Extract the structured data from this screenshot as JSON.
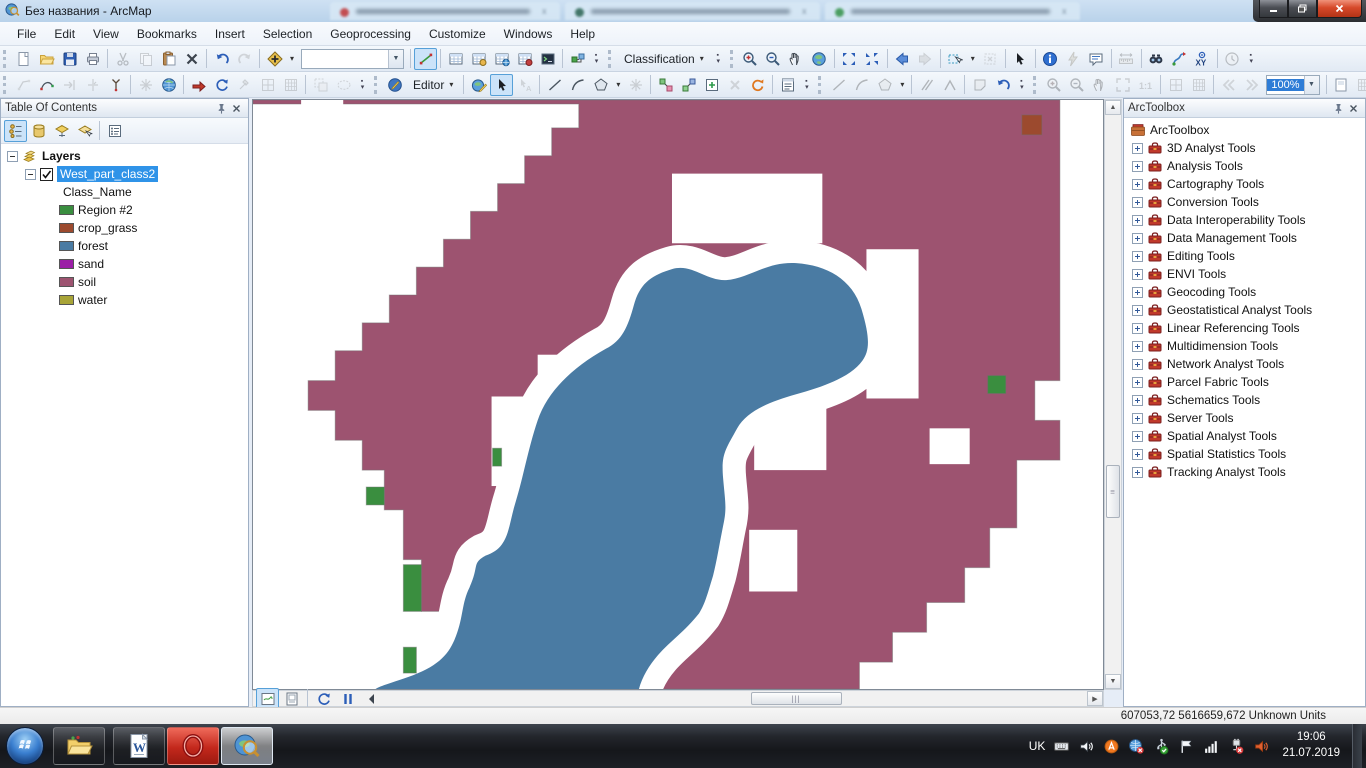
{
  "window": {
    "title": "Без названия - ArcMap",
    "controls": {
      "minimize": "minimize",
      "restore": "restore",
      "close": "close"
    }
  },
  "menubar": [
    "File",
    "Edit",
    "View",
    "Bookmarks",
    "Insert",
    "Selection",
    "Geoprocessing",
    "Customize",
    "Windows",
    "Help"
  ],
  "toolbars": {
    "row1": [
      {
        "tool": "standard",
        "items": [
          "grip",
          "icon:new-document",
          "icon:open-folder",
          "icon:save",
          "icon:print",
          "sep",
          "icon:cut:disabled",
          "icon:copy:disabled",
          "icon:paste",
          "icon:delete",
          "sep",
          "icon:undo",
          "icon:redo:disabled",
          "sep",
          "icon:add-data",
          "drop",
          "combo:scale:",
          "sep",
          "icon:edit-vertices:active",
          "sep",
          "icon:table-blue",
          "icon:table-yellow",
          "icon:table-globe",
          "icon:table-red",
          "icon:console",
          "sep",
          "icon:green-plug",
          "overflow"
        ]
      },
      {
        "tool": "classification",
        "items": [
          "grip",
          "label:Classification:drop",
          "overflow"
        ]
      },
      {
        "tool": "tools",
        "items": [
          "grip",
          "icon:zoom-in",
          "icon:zoom-out",
          "icon:pan",
          "icon:full-extent",
          "sep",
          "icon:fixed-zoom-in",
          "icon:fixed-zoom-out",
          "sep",
          "icon:back",
          "icon:forward:disabled",
          "sep",
          "icon:select-features",
          "drop",
          "icon:clear-selection:disabled",
          "sep",
          "icon:select-elements",
          "sep",
          "icon:identify",
          "icon:hyperlink:disabled",
          "icon:html-popup",
          "sep",
          "icon:measure:disabled",
          "sep",
          "icon:find",
          "icon:find-route",
          "icon:go-to-xy",
          "sep",
          "icon:time-slider:disabled",
          "overflow"
        ]
      }
    ],
    "row2": [
      {
        "tool": "topology",
        "items": [
          "grip",
          "icon:edge-sketch:disabled",
          "icon:curve-points",
          "icon:arrow-line:disabled",
          "icon:split-line:disabled",
          "icon:point-star",
          "sep",
          "icon:burst:disabled",
          "icon:globe-color",
          "sep",
          "icon:arrow-red",
          "icon:refresh-blue",
          "icon:hammer:disabled",
          "icon:grid-a:disabled",
          "icon:grid-b:disabled",
          "sep",
          "icon:copy-shape:disabled",
          "icon:ellipse:disabled",
          "overflow"
        ]
      },
      {
        "tool": "editor",
        "items": [
          "grip",
          "icon:editor-badge",
          "label:Editor:drop",
          "sep",
          "icon:globe-edit",
          "icon:select-elements:active",
          "icon:annotation-arrow:disabled",
          "sep",
          "icon:line",
          "icon:arc",
          "icon:polygon",
          "drop",
          "icon:burst:disabled",
          "sep",
          "icon:topology-a",
          "icon:topology-b",
          "icon:square-plus",
          "icon:x-gray:disabled",
          "icon:rotate-orange",
          "sep",
          "icon:attributes-list",
          "overflow"
        ]
      },
      {
        "tool": "advanced-editing",
        "items": [
          "grip",
          "icon:line:disabled",
          "icon:arc:disabled",
          "icon:polygon:disabled",
          "drop",
          "sep",
          "icon:parallel:disabled",
          "icon:perpendicular:disabled",
          "sep",
          "icon:clip:disabled",
          "icon:undo",
          "overflow"
        ]
      },
      {
        "tool": "viewer",
        "items": [
          "grip",
          "icon:zoom-in:disabled",
          "icon:zoom-out:disabled",
          "icon:pan:disabled",
          "icon:expand:disabled",
          "icon:one-to-one:disabled",
          "sep",
          "icon:grid-a:disabled",
          "icon:grid-b:disabled",
          "sep",
          "icon:page-left:disabled",
          "icon:page-right:disabled",
          "combo-small:zoom:100%:selected",
          "sep",
          "icon:page",
          "icon:grid-c:disabled",
          "icon:swipe",
          "icon:layers-color",
          "overflow"
        ]
      }
    ]
  },
  "toc": {
    "title": "Table Of Contents",
    "toolbar": [
      "icon:list-drawing-order:active",
      "icon:list-source",
      "icon:list-visibility",
      "icon:list-selection",
      "sep",
      "icon:options-list"
    ],
    "tree": {
      "root_label": "Layers",
      "layer_name": "West_part_class2",
      "layer_checked": true,
      "field_name": "Class_Name",
      "classes": [
        {
          "label": "Region #2",
          "color": "#3a8e3f"
        },
        {
          "label": "crop_grass",
          "color": "#9c4a2e"
        },
        {
          "label": "forest",
          "color": "#4a7ba3"
        },
        {
          "label": "sand",
          "color": "#9b1da6"
        },
        {
          "label": "soil",
          "color": "#9d5370"
        },
        {
          "label": "water",
          "color": "#a8a437"
        }
      ]
    }
  },
  "arctoolbox": {
    "title": "ArcToolbox",
    "root_label": "ArcToolbox",
    "tools": [
      "3D Analyst Tools",
      "Analysis Tools",
      "Cartography Tools",
      "Conversion Tools",
      "Data Interoperability Tools",
      "Data Management Tools",
      "Editing Tools",
      "ENVI Tools",
      "Geocoding Tools",
      "Geostatistical Analyst Tools",
      "Linear Referencing Tools",
      "Multidimension Tools",
      "Network Analyst Tools",
      "Parcel Fabric Tools",
      "Schematics Tools",
      "Server Tools",
      "Spatial Analyst Tools",
      "Spatial Statistics Tools",
      "Tracking Analyst Tools"
    ]
  },
  "map_controls": [
    "icon:data-view:active",
    "icon:layout-view",
    "sep",
    "icon:refresh-blue",
    "icon:pause-small",
    "icon:scroll-left"
  ],
  "statusbar": {
    "coordinates": "607053,72  5616659,672 Unknown Units"
  },
  "taskbar": {
    "language": "UK",
    "clock": {
      "time": "19:06",
      "date": "21.07.2019"
    },
    "apps": [
      {
        "id": "explorer",
        "active": false
      },
      {
        "id": "word",
        "active": false
      },
      {
        "id": "opera",
        "active": false
      },
      {
        "id": "arcmap",
        "active": true
      }
    ],
    "tray": [
      "keyboard",
      "volume",
      "avast",
      "network-error",
      "usb-ok",
      "flag",
      "signal",
      "power-error",
      "volume-red"
    ]
  }
}
